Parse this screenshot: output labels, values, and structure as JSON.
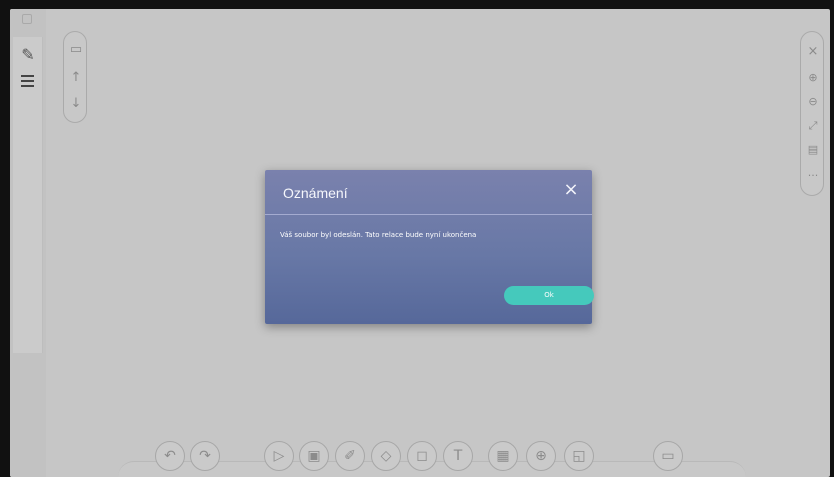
{
  "dialog": {
    "title": "Oznámení",
    "message": "Váš soubor byl odeslán. Tato relace bude nyní ukončena",
    "ok_label": "Ok",
    "close_icon": "close-icon",
    "accent_color": "#45c9bc",
    "header_color": "#7a81ad"
  },
  "left_toolbar": {
    "icons": [
      "document-icon",
      "pen-eraser-icon",
      "menu-icon"
    ]
  },
  "nav_pill": {
    "icons": [
      "window-icon",
      "arrow-up-icon",
      "arrow-down-icon"
    ]
  },
  "right_toolbar": {
    "icons": [
      "close-icon",
      "zoom-in-icon",
      "zoom-out-icon",
      "fit-screen-icon",
      "monitor-icon",
      "more-icon"
    ]
  },
  "bottom_toolbar": {
    "icons": [
      "undo-icon",
      "redo-icon",
      "select-cursor-icon",
      "slide-icon",
      "pen-icon",
      "eraser-icon",
      "shapes-icon",
      "text-icon",
      "table-icon",
      "globe-icon",
      "sticky-note-icon",
      "present-icon"
    ]
  }
}
